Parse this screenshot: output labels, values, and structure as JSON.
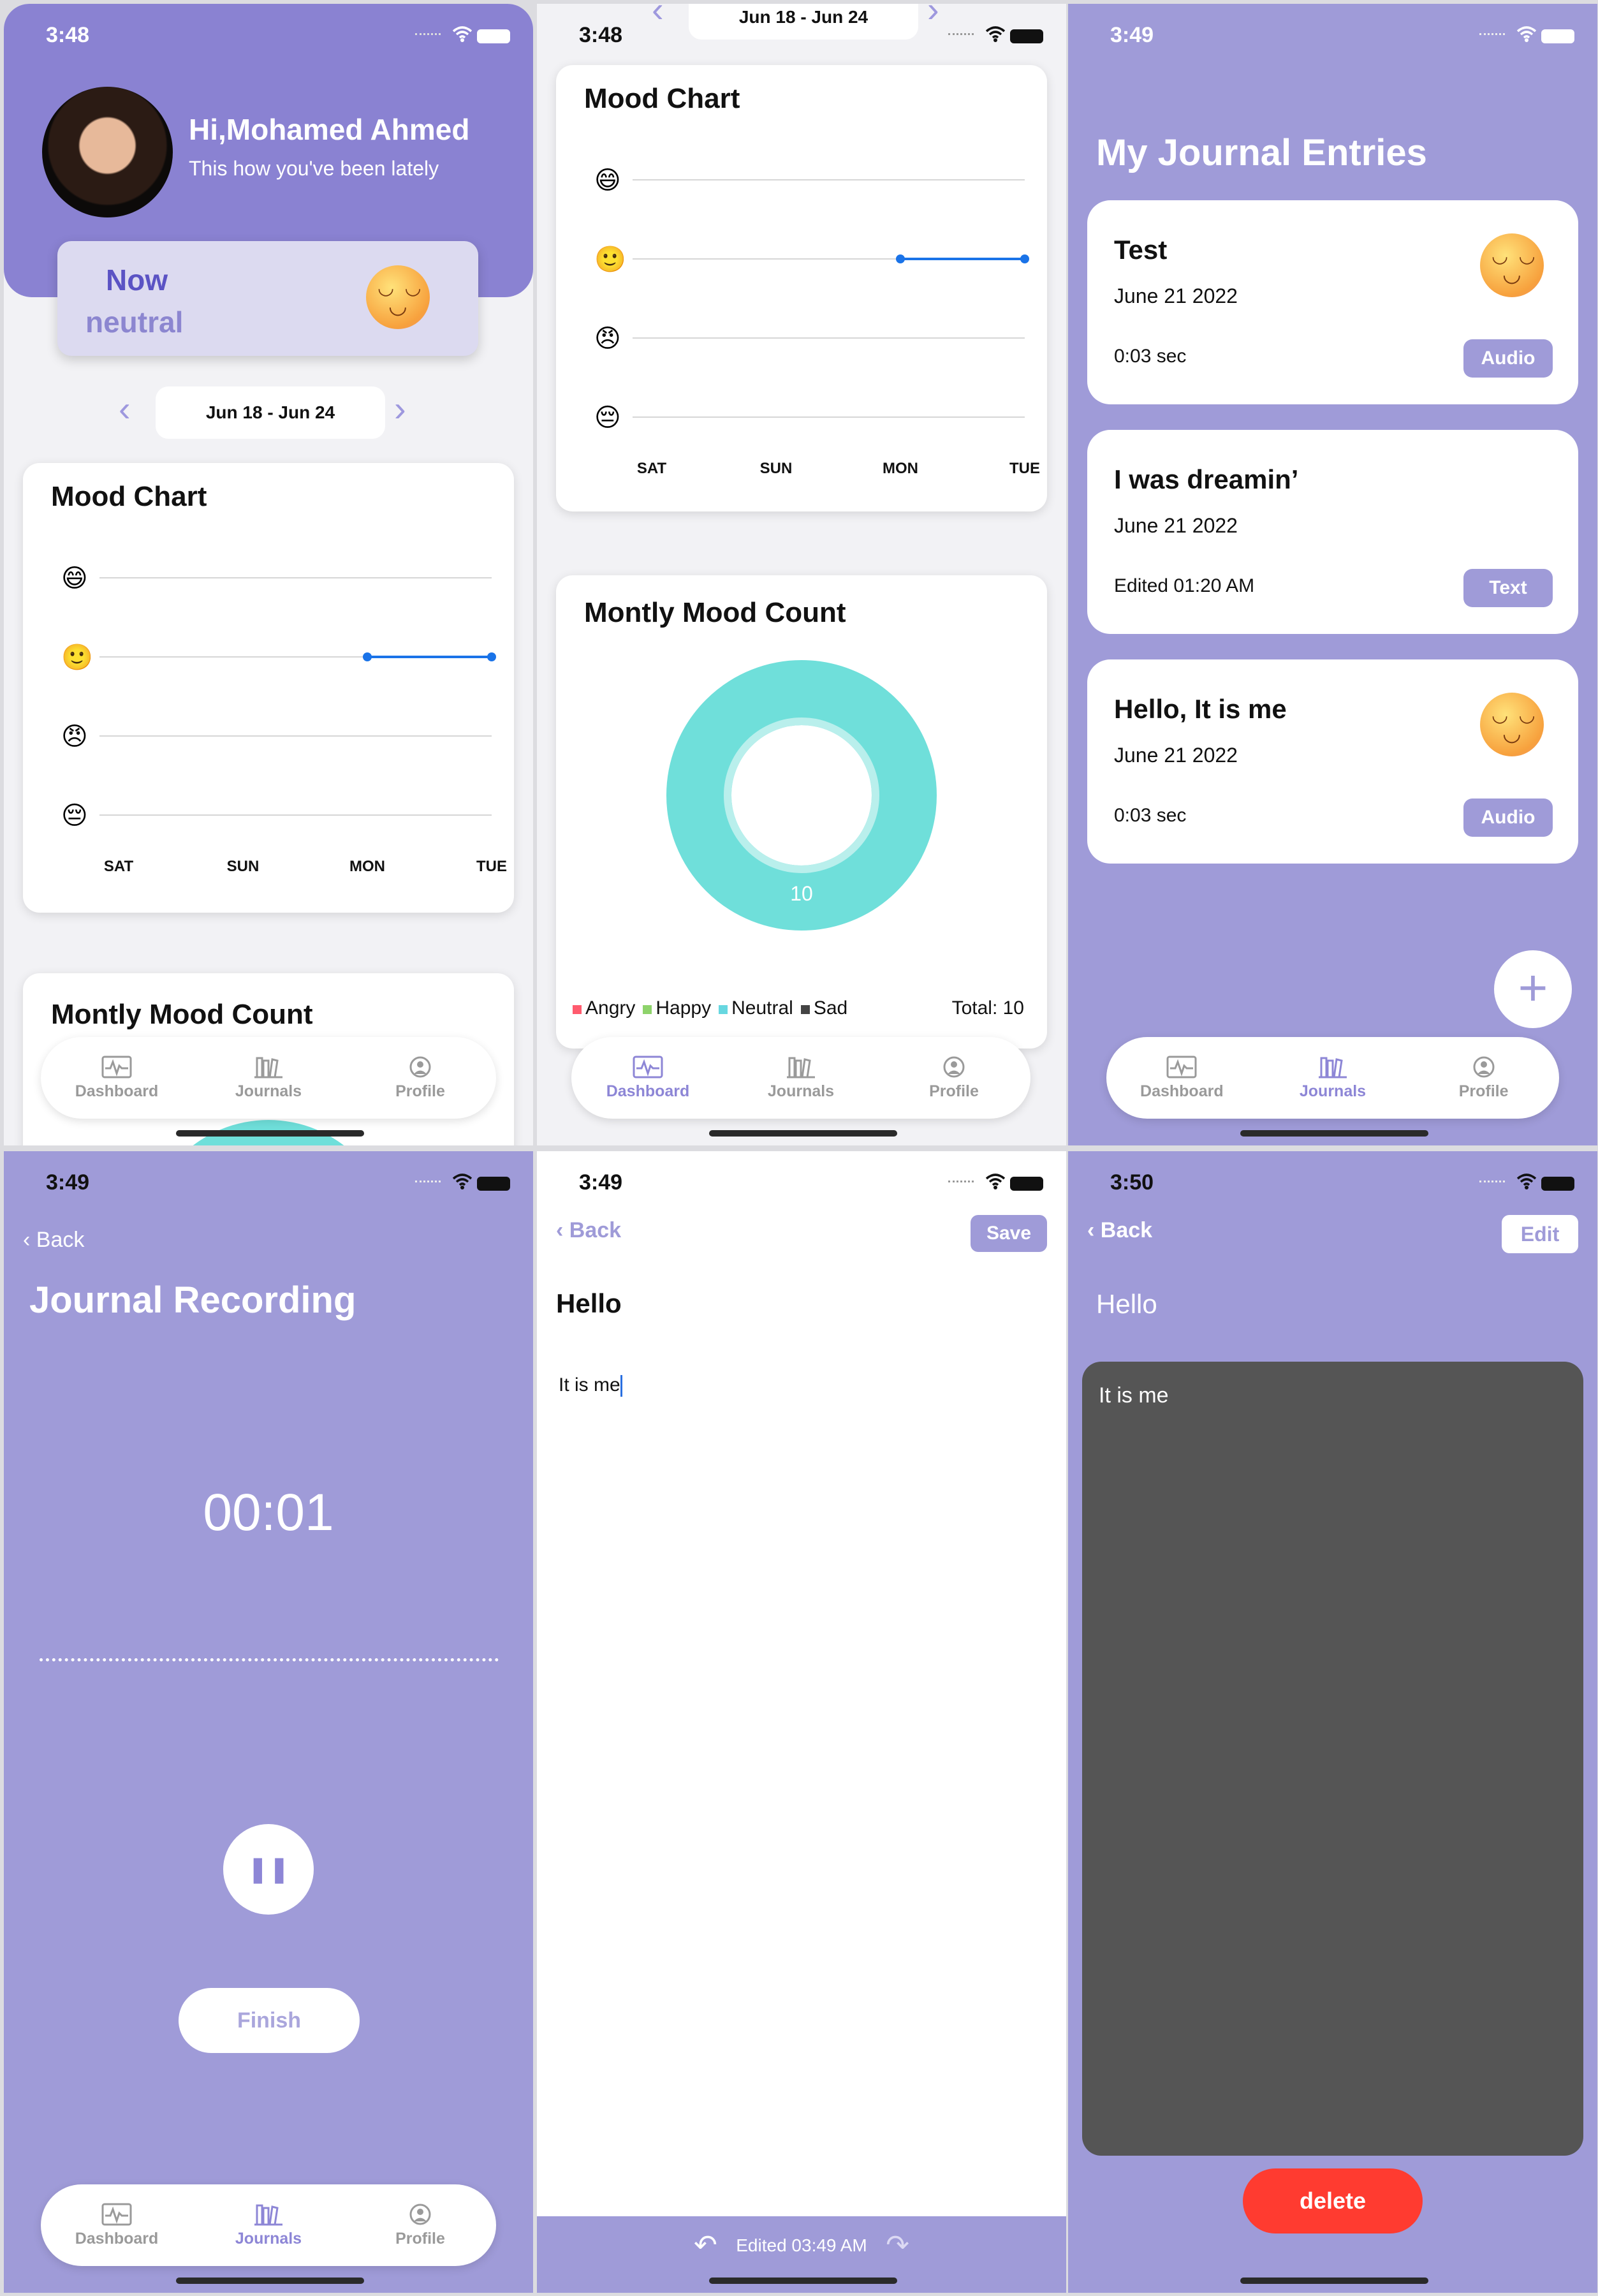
{
  "screens": {
    "dashboard": {
      "time": "3:48",
      "greeting": "Hi,Mohamed Ahmed",
      "subtitle": "This how you've been lately",
      "now_label": "Now",
      "now_mood": "neutral",
      "week_range": "Jun 18 - Jun 24",
      "mood_chart_title": "Mood Chart",
      "count_title": "Montly Mood Count"
    },
    "dashboard_scrolled": {
      "time": "3:48",
      "week_range": "Jun 18 - Jun 24",
      "mood_chart_title": "Mood Chart",
      "count_title": "Montly Mood Count",
      "total_label": "Total: 10"
    },
    "journals": {
      "time": "3:49",
      "title": "My Journal Entries",
      "entries": [
        {
          "title": "Test",
          "date": "June 21  2022",
          "meta": "0:03 sec",
          "type": "Audio",
          "emoji": "smiling-face"
        },
        {
          "title": "I was dreamin’",
          "date": "June 21  2022",
          "meta": "Edited 01:20 AM",
          "type": "Text",
          "emoji": ""
        },
        {
          "title": "Hello, It is me",
          "date": "June 21  2022",
          "meta": "0:03 sec",
          "type": "Audio",
          "emoji": "smiling-face"
        }
      ],
      "add_label": "+"
    },
    "recording": {
      "time": "3:49",
      "back": "Back",
      "title": "Journal Recording",
      "timer": "00:01",
      "pause_icon": "pause-icon",
      "finish": "Finish"
    },
    "editor": {
      "time": "3:49",
      "back": "Back",
      "save": "Save",
      "title": "Hello",
      "body": "It is me",
      "edited": "Edited 03:49 AM"
    },
    "detail": {
      "time": "3:50",
      "back": "Back",
      "edit": "Edit",
      "title": "Hello",
      "body": "It is me",
      "delete": "delete"
    }
  },
  "tabs": [
    "Dashboard",
    "Journals",
    "Profile"
  ],
  "colors": {
    "accent": "#9f9bd8",
    "header": "#8a82d2",
    "line_series": "#1a73e8",
    "donut_neutral": "#6fdfda",
    "angry": "#ff5b6e",
    "happy": "#8ed36b",
    "neutral": "#67d7e0",
    "sad": "#444444",
    "delete": "#ff3b30"
  },
  "chart_data": [
    {
      "type": "line",
      "title": "Mood Chart",
      "categories": [
        "SAT",
        "SUN",
        "MON",
        "TUE"
      ],
      "y_levels": [
        "grinning-icon",
        "slight-smile-icon",
        "angry-icon",
        "sad-icon"
      ],
      "series": [
        {
          "values": [
            null,
            null,
            2,
            2
          ]
        }
      ]
    },
    {
      "type": "pie",
      "title": "Montly Mood Count",
      "slices": [
        {
          "label": "Angry",
          "value": 0
        },
        {
          "label": "Happy",
          "value": 0
        },
        {
          "label": "Neutral",
          "value": 10
        },
        {
          "label": "Sad",
          "value": 0
        }
      ],
      "total": 10
    }
  ]
}
